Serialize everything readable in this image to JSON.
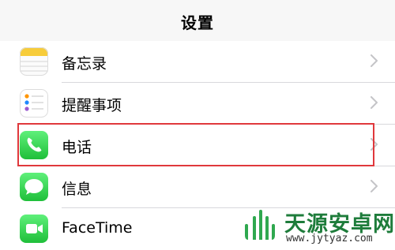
{
  "nav": {
    "title": "设置"
  },
  "rows": [
    {
      "label": "备忘录",
      "icon": "notes-icon"
    },
    {
      "label": "提醒事项",
      "icon": "reminders-icon"
    },
    {
      "label": "电话",
      "icon": "phone-icon"
    },
    {
      "label": "信息",
      "icon": "messages-icon"
    },
    {
      "label": "FaceTime",
      "icon": "facetime-icon"
    }
  ],
  "highlight": {
    "row_label": "电话",
    "color": "#e0383c"
  },
  "watermark": {
    "title": "天源安卓网",
    "url": "www.jytyaz.com"
  },
  "colors": {
    "green": "#34c759",
    "accent_red": "#e0383c",
    "chevron": "#c4c4c7"
  }
}
